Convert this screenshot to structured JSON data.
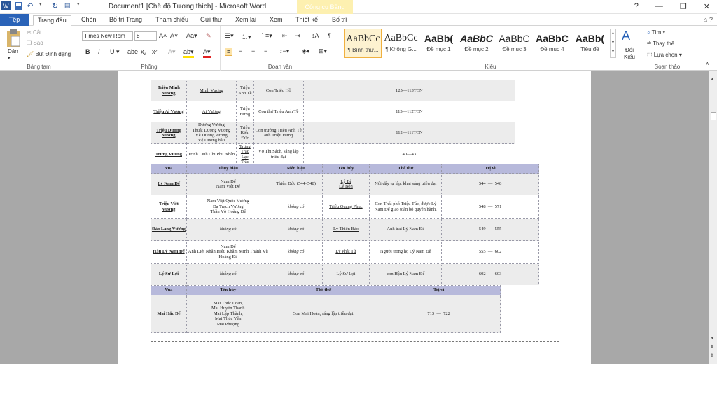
{
  "window": {
    "title": "Document1 [Chế độ Tương thích]  -  Microsoft Word",
    "context_tab": "Công cụ Bảng",
    "controls": [
      "?",
      "—",
      "❐",
      "✕"
    ]
  },
  "tabs": {
    "file": "Tệp",
    "items": [
      "Trang đầu",
      "Chèn",
      "Bố trí Trang",
      "Tham chiếu",
      "Gửi thư",
      "Xem lại",
      "Xem",
      "Thiết kế",
      "Bố trí"
    ],
    "active": "Trang đầu",
    "help": "⌂ ?"
  },
  "ribbon": {
    "clipboard": {
      "paste": "Dán",
      "cut": "Cắt",
      "copy": "Sao",
      "format_painter": "Bút Định dạng",
      "label": "Bảng tạm"
    },
    "font": {
      "name": "Times New Rom",
      "size": "8",
      "label": "Phông"
    },
    "paragraph": {
      "label": "Đoạn văn"
    },
    "styles": {
      "items": [
        {
          "sample": "AaBbCc",
          "name": "¶ Bình thư..."
        },
        {
          "sample": "AaBbCc",
          "name": "¶ Không G..."
        },
        {
          "sample": "AaBb(",
          "name": "Đề mục 1"
        },
        {
          "sample": "AaBbC",
          "name": "Đề mục 2"
        },
        {
          "sample": "AaBbC",
          "name": "Đề mục 3"
        },
        {
          "sample": "AaBbC",
          "name": "Đề mục 4"
        },
        {
          "sample": "AaBb(",
          "name": "Tiêu đề"
        }
      ],
      "change": "Đổi Kiểu",
      "label": "Kiểu"
    },
    "editing": {
      "find": "Tìm",
      "replace": "Thay thế",
      "select": "Lựa chọn",
      "label": "Soạn thảo"
    }
  },
  "table1": {
    "rows": [
      [
        "Triệu Minh Vương",
        "Minh Vương",
        "Triệu Anh Tề",
        "Con Triệu Hồ",
        "125—113TCN"
      ],
      [
        "Triệu Ai Vương",
        "Ai Vương",
        "Triệu Hưng",
        "Con thứ Triệu Anh Tề",
        "113—112TCN"
      ],
      [
        "Triệu Dương Vương",
        "Dương Vương\nThuật Dương Vương\nVệ Dương vương\nVệ Dương hầu",
        "Triệu Kiến Đức",
        "Con trưởng Triệu Anh Tề\nanh Triệu Hưng",
        "112—111TCN"
      ],
      [
        "Trưng Vương",
        "Trinh Linh Chi Phu Nhân",
        "Trưng Trắc\nLạc Trắc",
        "Vợ Thi Sách, sáng lập triều đại",
        "40—43"
      ]
    ]
  },
  "table2": {
    "header": [
      "Vua",
      "Thụy hiệu",
      "Niên hiệu",
      "Tên húy",
      "Thế thứ",
      "Trị vì"
    ],
    "rows": [
      [
        "Lý Nam Đế",
        "Nam Đế\nNam Việt Đế",
        "Thiên Đức (544–548)",
        "Lý Bí\nLý Bôn",
        "Nối dậy tự lập, khai sáng triều đại",
        "544",
        "548"
      ],
      [
        "Triệu Việt Vương",
        "Nam Việt Quốc Vương\nDạ Trạch Vương\nThần Võ Hoàng Đế",
        "không có",
        "Triệu Quang Phục",
        "Con Thái phó Triệu Túc, được Lý Nam Đế giao toàn bộ quyền hành.",
        "548",
        "571"
      ],
      [
        "Đào Lang Vương",
        "không có",
        "không có",
        "Lý Thiên Bảo",
        "Anh trai Lý Nam Đế",
        "549",
        "555"
      ],
      [
        "Hậu Lý Nam Đế",
        "Nam Đế\nAnh Liệt Nhân Hiếu Khâm Minh Thánh Vũ Hoàng Đế",
        "không có",
        "Lý Phật Tử",
        "Người trong họ Lý Nam Đế",
        "555",
        "602"
      ],
      [
        "Lý Sư Lợi",
        "không có",
        "không có",
        "Lý Sư Lợi",
        "con Hậu Lý Nam Đế",
        "602",
        "603"
      ]
    ]
  },
  "table3": {
    "header": [
      "Vua",
      "Tên húy",
      "Thế thứ",
      "Trị vì"
    ],
    "rows": [
      [
        "Mai Hắc Đế",
        "Mai Thúc Loan,\nMai Huyền Thành\nMai Lập Thành,\nMai Thúc Yên\nMai Phượng",
        "Con Mai Hoàn, sáng lập triều đại.",
        "713",
        "722"
      ]
    ]
  }
}
